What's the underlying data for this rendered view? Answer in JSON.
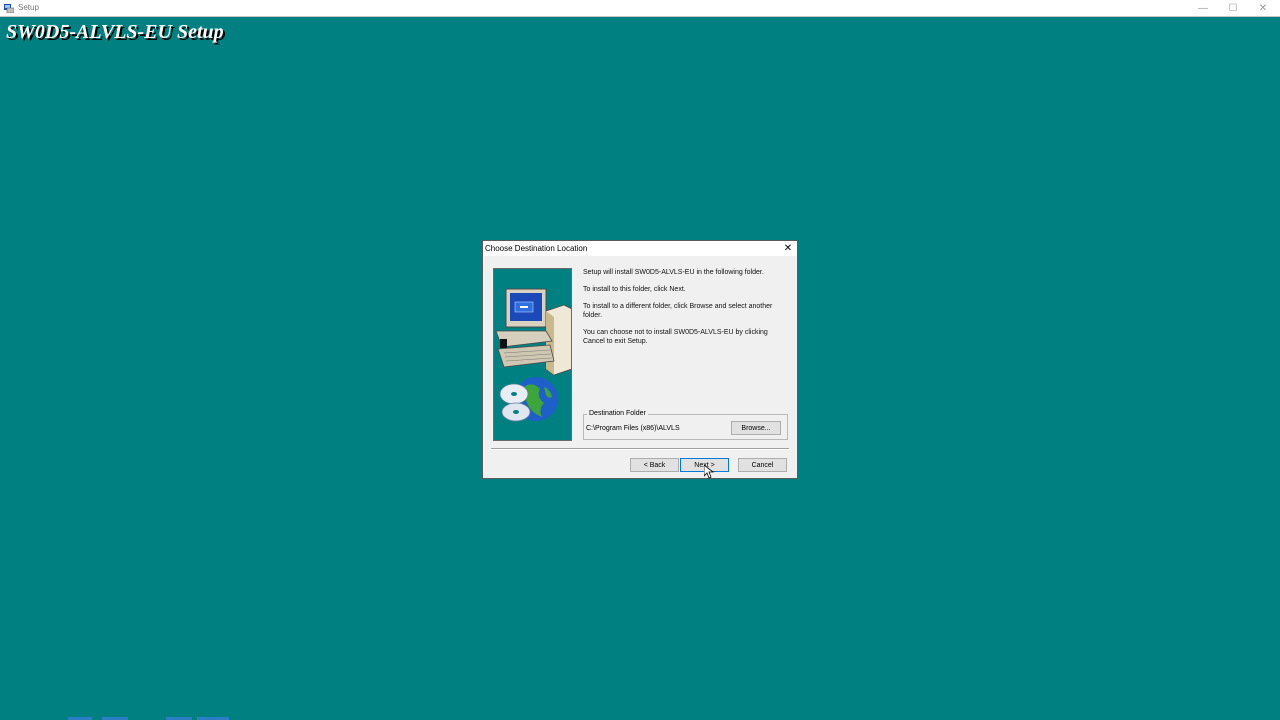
{
  "window": {
    "title": "Setup",
    "icon": "setup-app-icon",
    "controls": {
      "minimize": "—",
      "maximize": "☐",
      "close": "✕"
    }
  },
  "heading": "SW0D5-ALVLS-EU Setup",
  "dialog": {
    "title": "Choose Destination Location",
    "close_glyph": "✕",
    "art": "computer-and-globe-illustration",
    "lines": [
      "Setup will install SW0D5-ALVLS-EU in the following folder.",
      "To install to this folder, click Next.",
      "To install to a different folder, click Browse and select another",
      "folder.",
      "You can choose not to install SW0D5-ALVLS-EU by clicking",
      "Cancel to exit Setup."
    ],
    "destination": {
      "legend": "Destination Folder",
      "path": "C:\\Program Files (x86)\\ALVLS",
      "browse_label": "Browse..."
    },
    "buttons": {
      "back": "< Back",
      "next": "Next >",
      "cancel": "Cancel"
    }
  },
  "colors": {
    "desktop": "#008080",
    "dialog_bg": "#f0f0f0",
    "focus_border": "#0078d7"
  }
}
